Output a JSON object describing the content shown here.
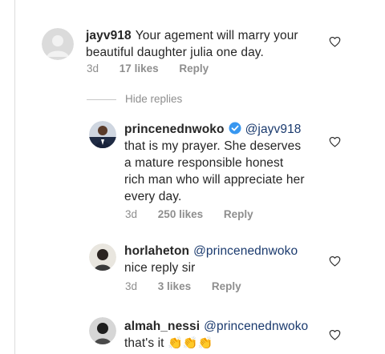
{
  "comments": [
    {
      "username": "jayv918",
      "text_line1": "Your agement will marry your",
      "text_line2": "beautiful daughter julia one day.",
      "time": "3d",
      "likes": "17 likes",
      "reply": "Reply"
    },
    {
      "username": "princenednwoko",
      "mention": "@jayv918",
      "text_line1": "that is my prayer. She deserves",
      "text_line2": "a mature responsible honest",
      "text_line3": "rich man who will appreciate her",
      "text_line4": "every day.",
      "time": "3d",
      "likes": "250 likes",
      "reply": "Reply",
      "verified": true
    },
    {
      "username": "horlaheton",
      "mention": "@princenednwoko",
      "text_line1": "nice reply sir",
      "time": "3d",
      "likes": "3 likes",
      "reply": "Reply"
    },
    {
      "username": "almah_nessi",
      "mention": "@princenednwoko",
      "text_line1": "that's it",
      "emoji": "👏👏👏"
    }
  ],
  "hide_replies": "Hide replies",
  "icons": {
    "heart": "heart-outline-icon",
    "verified": "verified-badge-icon"
  },
  "colors": {
    "verified": "#3897f0",
    "mention": "#1a3a6e",
    "meta": "#8e8e8e",
    "emoji": "#f5b800"
  }
}
